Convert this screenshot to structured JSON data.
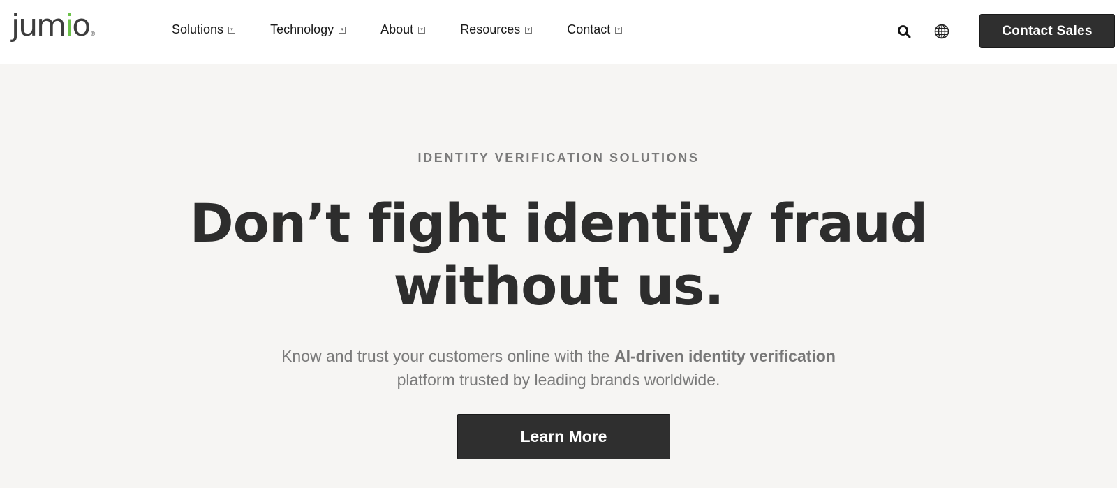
{
  "header": {
    "logo": {
      "prefix": "jum",
      "accent": "i",
      "suffix": "o",
      "registered": "®"
    },
    "nav": [
      {
        "label": "Solutions",
        "icon": "chevron-down-icon"
      },
      {
        "label": "Technology",
        "icon": "chevron-down-icon"
      },
      {
        "label": "About",
        "icon": "chevron-down-icon"
      },
      {
        "label": "Resources",
        "icon": "chevron-down-icon"
      },
      {
        "label": "Contact",
        "icon": "chevron-down-icon"
      }
    ],
    "search_icon": "search-icon",
    "language_icon": "globe-icon",
    "cta_label": "Contact Sales"
  },
  "hero": {
    "eyebrow": "IDENTITY VERIFICATION SOLUTIONS",
    "headline_line1": "Don’t fight identity fraud",
    "headline_line2": "without us.",
    "sub_part1": "Know and trust your customers online with the ",
    "sub_bold": "AI-driven identity verification",
    "sub_part2": "platform trusted by leading brands worldwide.",
    "cta_label": "Learn More"
  },
  "colors": {
    "brand_green": "#6cc24a",
    "dark_button": "#2f2f2f",
    "hero_background": "#f6f5f3",
    "header_background": "#ffffff"
  }
}
